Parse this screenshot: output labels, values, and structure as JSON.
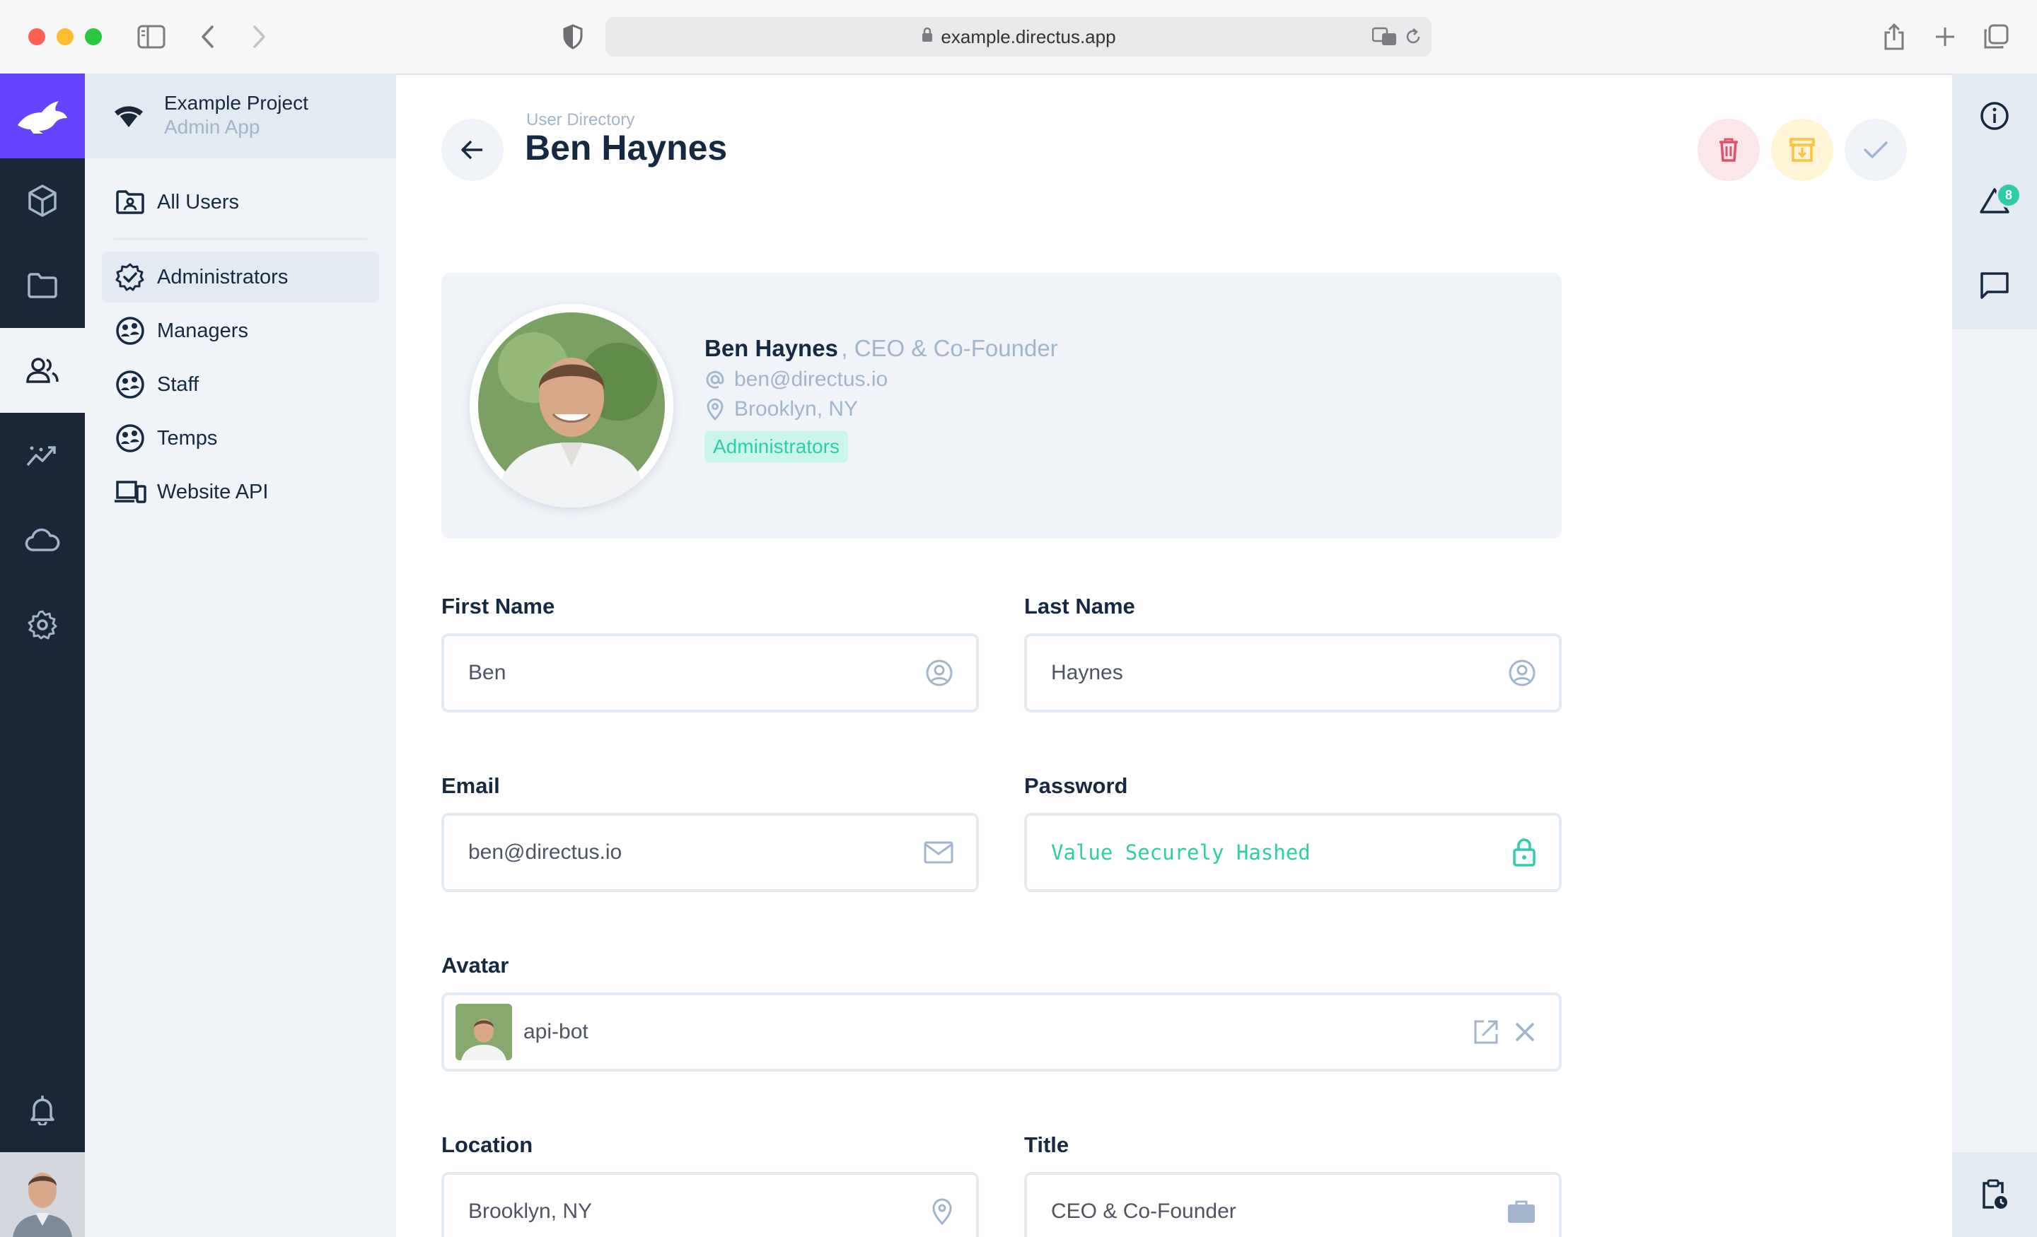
{
  "browser": {
    "url": "example.directus.app",
    "colors": {
      "close": "#fe5f57",
      "minimize": "#febc2e",
      "zoom": "#28c840"
    }
  },
  "rail": {
    "items": [
      {
        "icon": "directus-rabbit-logo"
      },
      {
        "icon": "cube-icon"
      },
      {
        "icon": "folder-icon"
      },
      {
        "icon": "users-icon"
      },
      {
        "icon": "insights-icon"
      },
      {
        "icon": "cloud-icon"
      },
      {
        "icon": "gear-icon"
      },
      {
        "icon": "bell-icon"
      }
    ]
  },
  "project": {
    "name": "Example Project",
    "subtitle": "Admin App"
  },
  "sidebar": {
    "items": [
      {
        "label": "All Users",
        "icon": "folder-user-icon"
      },
      {
        "label": "Administrators",
        "icon": "verified-badge-icon",
        "active": true
      },
      {
        "label": "Managers",
        "icon": "group-icon"
      },
      {
        "label": "Staff",
        "icon": "group-icon"
      },
      {
        "label": "Temps",
        "icon": "group-icon"
      },
      {
        "label": "Website API",
        "icon": "devices-icon"
      }
    ]
  },
  "header": {
    "breadcrumb": "User Directory",
    "title": "Ben Haynes"
  },
  "actions": {
    "delete_color": "#e35169",
    "archive_color": "#ffc23b",
    "save_color": "#a2b5cd"
  },
  "profile": {
    "name": "Ben Haynes",
    "title": ", CEO & Co-Founder",
    "email": "ben@directus.io",
    "location": "Brooklyn, NY",
    "role": "Administrators"
  },
  "form": {
    "first_name": {
      "label": "First Name",
      "value": "Ben"
    },
    "last_name": {
      "label": "Last Name",
      "value": "Haynes"
    },
    "email": {
      "label": "Email",
      "value": "ben@directus.io"
    },
    "password": {
      "label": "Password",
      "value": "Value Securely Hashed"
    },
    "avatar": {
      "label": "Avatar",
      "value": "api-bot"
    },
    "location": {
      "label": "Location",
      "value": "Brooklyn, NY"
    },
    "title": {
      "label": "Title",
      "value": "CEO & Co-Founder"
    }
  },
  "right_sidebar": {
    "notification_count": "8"
  },
  "theme": {
    "primary": "#6644ff",
    "rail_bg": "#1b2637",
    "accent": "#2ecda7"
  }
}
